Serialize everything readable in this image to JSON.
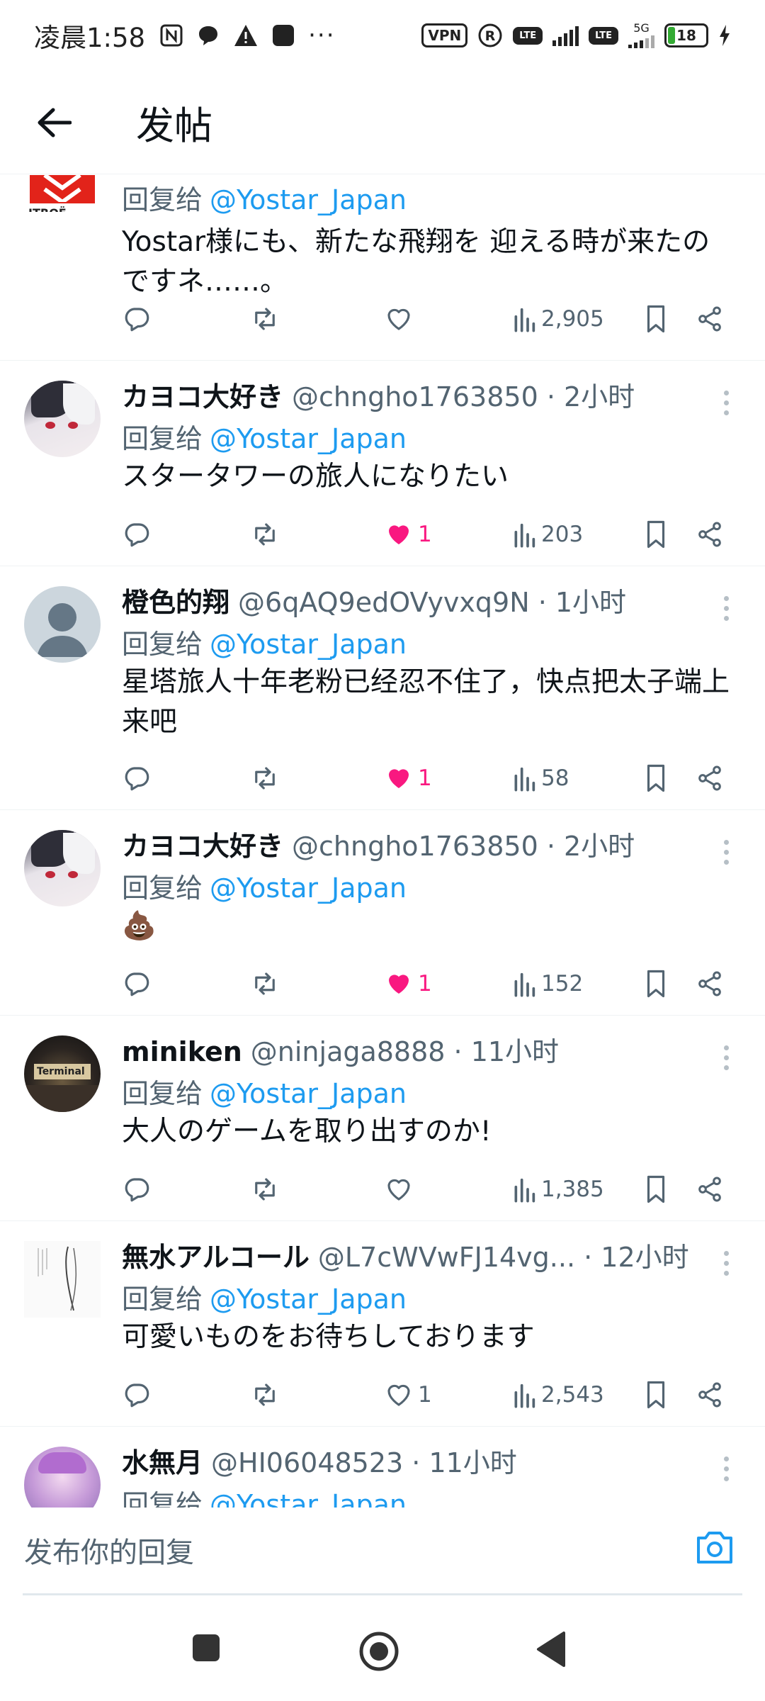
{
  "status_bar": {
    "time": "凌晨1:58",
    "more": "···",
    "vpn": "VPN",
    "r": "R",
    "lte1": "LTE",
    "lte2": "LTE",
    "net5g": "5G",
    "battery": "18"
  },
  "header": {
    "title": "发帖"
  },
  "reply_prefix": "回复给",
  "reply_to": "@Yostar_Japan",
  "colors": {
    "accent": "#1d9bf0",
    "like": "#f91880",
    "text": "#0f1419",
    "muted": "#536471"
  },
  "tweets": [
    {
      "name": "",
      "handle": "",
      "time": "",
      "text": "Yostar様にも、新たな飛翔を 迎える時が来たのですネ……。",
      "like_count": "",
      "liked": false,
      "views": "2,905",
      "retweet_count": ""
    },
    {
      "name": "カヨコ大好き",
      "handle": "@chngho1763850 · 2小时",
      "text": "スタータワーの旅人になりたい",
      "like_count": "1",
      "liked": true,
      "views": "203"
    },
    {
      "name": "橙色的翔",
      "handle": "@6qAQ9edOVyvxq9N · 1小时",
      "text": "星塔旅人十年老粉已经忍不住了，快点把太子端上来吧",
      "like_count": "1",
      "liked": true,
      "views": "58"
    },
    {
      "name": "カヨコ大好き",
      "handle": "@chngho1763850 · 2小时",
      "text": "💩",
      "like_count": "1",
      "liked": true,
      "views": "152"
    },
    {
      "name": "miniken",
      "handle": "@ninjaga8888 · 11小时",
      "text": "大人のゲームを取り出すのか!",
      "like_count": "",
      "liked": false,
      "views": "1,385"
    },
    {
      "name": "無水アルコール",
      "handle": "@L7cWVwFJ14vg... · 12小时",
      "text": "可愛いものをお待ちしております",
      "like_count": "1",
      "liked": false,
      "views": "2,543"
    },
    {
      "name": "水無月",
      "handle": "@HI06048523 · 11小时",
      "text": "",
      "like_count": "",
      "liked": false,
      "views": ""
    }
  ],
  "reply_bar": {
    "placeholder": "发布你的回复"
  },
  "icons": {
    "back": "arrow-left-icon",
    "reply": "comment-icon",
    "retweet": "retweet-icon",
    "like": "heart-icon",
    "views": "bar-chart-icon",
    "bookmark": "bookmark-icon",
    "share": "share-icon",
    "camera": "camera-icon"
  }
}
